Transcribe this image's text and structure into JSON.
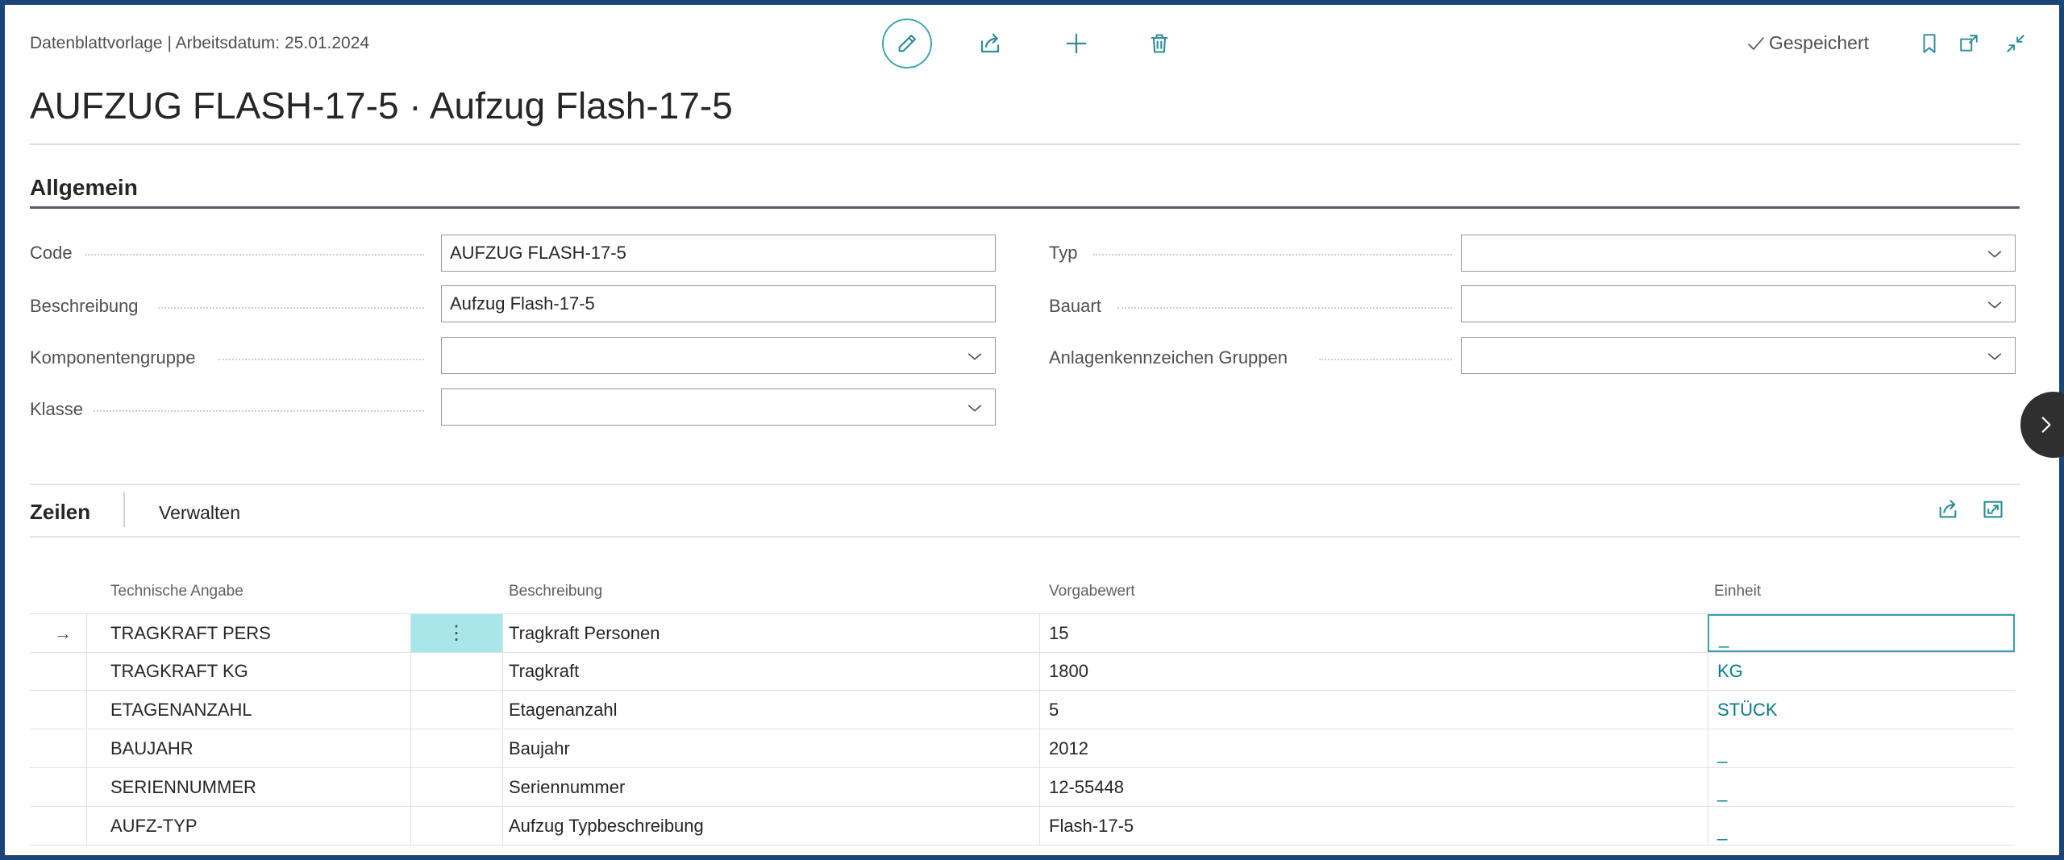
{
  "header": {
    "context_label": "Datenblattvorlage | Arbeitsdatum: 25.01.2024",
    "title": "AUFZUG FLASH-17-5 · Aufzug Flash-17-5",
    "saved_status": "Gespeichert"
  },
  "toolbar": {
    "icons": [
      "edit-pencil-icon",
      "share-icon",
      "plus-icon",
      "trash-icon"
    ],
    "right_icons": [
      "bookmark-icon",
      "open-new-window-icon",
      "collapse-icon"
    ]
  },
  "general": {
    "section_title": "Allgemein",
    "left_fields": [
      {
        "label": "Code",
        "value": "AUFZUG FLASH-17-5",
        "kind": "text"
      },
      {
        "label": "Beschreibung",
        "value": "Aufzug Flash-17-5",
        "kind": "text"
      },
      {
        "label": "Komponentengruppe",
        "value": "",
        "kind": "select"
      },
      {
        "label": "Klasse",
        "value": "",
        "kind": "select"
      }
    ],
    "right_fields": [
      {
        "label": "Typ",
        "value": "",
        "kind": "select"
      },
      {
        "label": "Bauart",
        "value": "",
        "kind": "select"
      },
      {
        "label": "Anlagenkennzeichen Gruppen",
        "value": "",
        "kind": "select"
      }
    ]
  },
  "lines": {
    "tabs": [
      "Zeilen",
      "Verwalten"
    ],
    "columns": [
      "Technische Angabe",
      "Beschreibung",
      "Vorgabewert",
      "Einheit"
    ],
    "rows": [
      {
        "tech": "TRAGKRAFT PERS",
        "desc": "Tragkraft Personen",
        "value": "15",
        "unit": "_"
      },
      {
        "tech": "TRAGKRAFT KG",
        "desc": "Tragkraft",
        "value": "1800",
        "unit": "KG"
      },
      {
        "tech": "ETAGENANZAHL",
        "desc": "Etagenanzahl",
        "value": "5",
        "unit": "STÜCK"
      },
      {
        "tech": "BAUJAHR",
        "desc": "Baujahr",
        "value": "2012",
        "unit": "_"
      },
      {
        "tech": "SERIENNUMMER",
        "desc": "Seriennummer",
        "value": "12-55448",
        "unit": "_"
      },
      {
        "tech": "AUFZ-TYP",
        "desc": "Aufzug Typbeschreibung",
        "value": "Flash-17-5",
        "unit": "_"
      }
    ],
    "selected_row_marker": "→",
    "row_menu_glyph": "⋮"
  },
  "colors": {
    "frame": "#1c4577",
    "accent": "#0a7a8a",
    "selected_cell": "#a9e6ea"
  }
}
